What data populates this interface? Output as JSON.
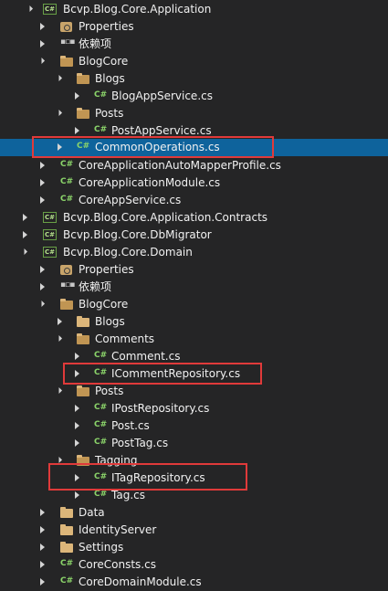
{
  "tree": {
    "items": [
      {
        "label": "Bcvp.Blog.Core.Application",
        "icon": "csharp-project-icon"
      },
      {
        "label": "Properties",
        "icon": "properties-icon"
      },
      {
        "label": "依赖项",
        "icon": "dependencies-icon"
      },
      {
        "label": "BlogCore",
        "icon": "folder-icon"
      },
      {
        "label": "Blogs",
        "icon": "folder-icon"
      },
      {
        "label": "BlogAppService.cs",
        "icon": "csharp-file-icon"
      },
      {
        "label": "Posts",
        "icon": "folder-icon"
      },
      {
        "label": "PostAppService.cs",
        "icon": "csharp-file-icon"
      },
      {
        "label": "CommonOperations.cs",
        "icon": "csharp-file-icon"
      },
      {
        "label": "CoreApplicationAutoMapperProfile.cs",
        "icon": "csharp-file-icon"
      },
      {
        "label": "CoreApplicationModule.cs",
        "icon": "csharp-file-icon"
      },
      {
        "label": "CoreAppService.cs",
        "icon": "csharp-file-icon"
      },
      {
        "label": "Bcvp.Blog.Core.Application.Contracts",
        "icon": "csharp-project-icon"
      },
      {
        "label": "Bcvp.Blog.Core.DbMigrator",
        "icon": "csharp-project-icon"
      },
      {
        "label": "Bcvp.Blog.Core.Domain",
        "icon": "csharp-project-icon"
      },
      {
        "label": "Properties",
        "icon": "properties-icon"
      },
      {
        "label": "依赖项",
        "icon": "dependencies-icon"
      },
      {
        "label": "BlogCore",
        "icon": "folder-icon"
      },
      {
        "label": "Blogs",
        "icon": "folder-icon"
      },
      {
        "label": "Comments",
        "icon": "folder-icon"
      },
      {
        "label": "Comment.cs",
        "icon": "csharp-file-icon"
      },
      {
        "label": "ICommentRepository.cs",
        "icon": "csharp-file-icon"
      },
      {
        "label": "Posts",
        "icon": "folder-icon"
      },
      {
        "label": "IPostRepository.cs",
        "icon": "csharp-file-icon"
      },
      {
        "label": "Post.cs",
        "icon": "csharp-file-icon"
      },
      {
        "label": "PostTag.cs",
        "icon": "csharp-file-icon"
      },
      {
        "label": "Tagging",
        "icon": "folder-icon"
      },
      {
        "label": "ITagRepository.cs",
        "icon": "csharp-file-icon"
      },
      {
        "label": "Tag.cs",
        "icon": "csharp-file-icon"
      },
      {
        "label": "Data",
        "icon": "folder-icon"
      },
      {
        "label": "IdentityServer",
        "icon": "folder-icon"
      },
      {
        "label": "Settings",
        "icon": "folder-icon"
      },
      {
        "label": "CoreConsts.cs",
        "icon": "csharp-file-icon"
      },
      {
        "label": "CoreDomainModule.cs",
        "icon": "csharp-file-icon"
      }
    ]
  },
  "colors": {
    "background": "#252526",
    "selection": "#0e639c",
    "highlight_box": "#e03a3a"
  }
}
